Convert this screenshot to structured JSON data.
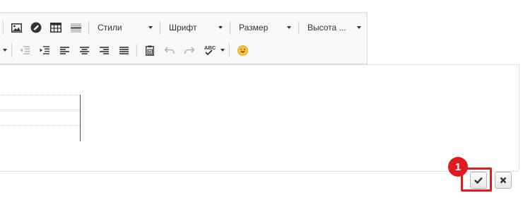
{
  "toolbar": {
    "styles_label": "Стили",
    "font_label": "Шрифт",
    "size_label": "Размер",
    "line_height_label": "Высота ..."
  },
  "icons": {
    "image": "image-icon",
    "link": "link-icon",
    "table": "table-icon",
    "hr": "horizontal-line-icon",
    "spellcheck": "spellcheck-icon",
    "emoji": "emoji-icon"
  },
  "spellcheck_text": "ABC",
  "callout": {
    "number": "1"
  },
  "colors": {
    "accent_red": "#e11b22"
  }
}
